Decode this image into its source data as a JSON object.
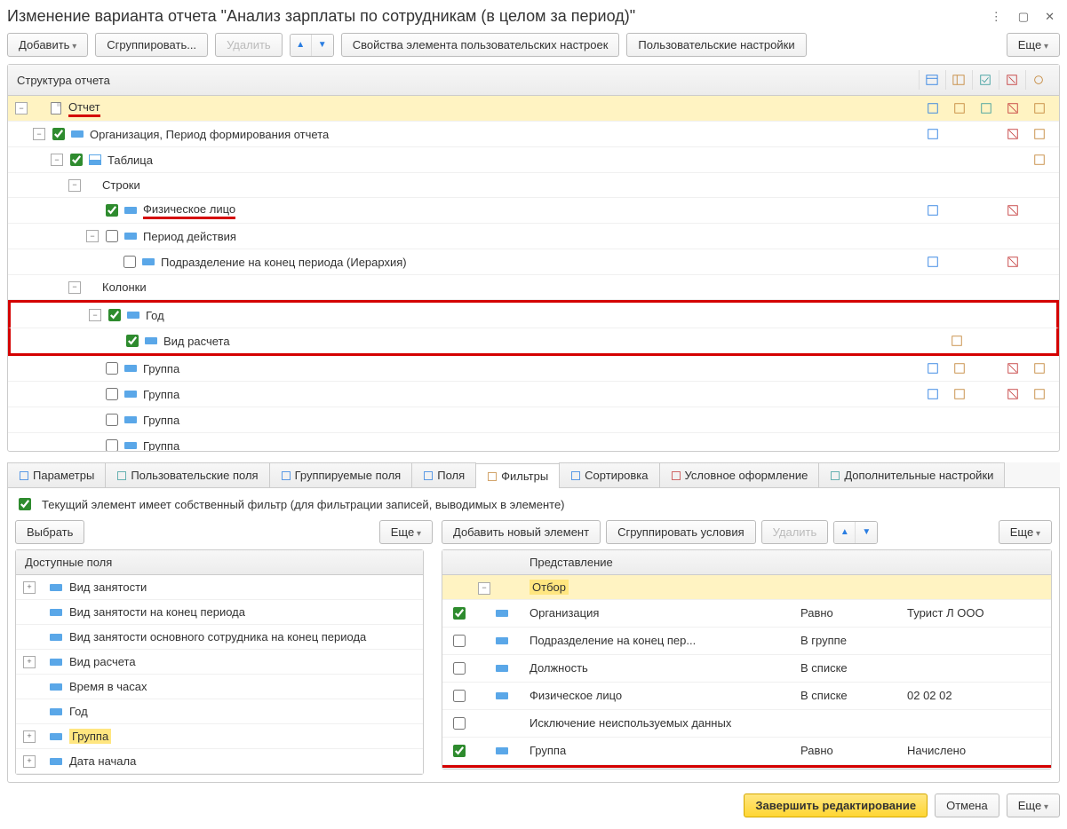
{
  "window": {
    "title": "Изменение варианта отчета \"Анализ зарплаты по сотрудникам (в целом за период)\""
  },
  "toolbar": {
    "add": "Добавить",
    "group": "Сгруппировать...",
    "delete": "Удалить",
    "props": "Свойства элемента пользовательских настроек",
    "user_settings": "Пользовательские настройки",
    "more": "Еще"
  },
  "structure": {
    "header": "Структура отчета",
    "rows": [
      {
        "indent": 0,
        "expander": "-",
        "cb": null,
        "icon": "doc",
        "label": "Отчет",
        "selected": true,
        "underline": true,
        "icons": [
          "blue",
          "orange",
          "teal",
          "red",
          "orange2"
        ]
      },
      {
        "indent": 1,
        "expander": "-",
        "cb": true,
        "icon": "field",
        "label": "Организация, Период формирования отчета",
        "icons": [
          "blue",
          "",
          "",
          "red",
          "orange2"
        ]
      },
      {
        "indent": 2,
        "expander": "-",
        "cb": true,
        "icon": "table",
        "label": "Таблица",
        "icons": [
          "",
          "",
          "",
          "",
          "orange2"
        ]
      },
      {
        "indent": 3,
        "expander": "-",
        "cb": null,
        "icon": "",
        "label": "Строки"
      },
      {
        "indent": 4,
        "expander": "",
        "cb": true,
        "icon": "field",
        "label": "Физическое лицо",
        "underline": true,
        "icons": [
          "blue",
          "",
          "",
          "red",
          ""
        ]
      },
      {
        "indent": 4,
        "expander": "-",
        "cb": false,
        "icon": "field",
        "label": "Период действия"
      },
      {
        "indent": 5,
        "expander": "",
        "cb": false,
        "icon": "field",
        "label": "Подразделение на конец периода (Иерархия)",
        "icons": [
          "blue",
          "",
          "",
          "red",
          ""
        ]
      },
      {
        "indent": 3,
        "expander": "-",
        "cb": null,
        "icon": "",
        "label": "Колонки"
      },
      {
        "indent": 4,
        "expander": "-",
        "cb": true,
        "icon": "field",
        "label": "Год",
        "boxed_start": true
      },
      {
        "indent": 5,
        "expander": "",
        "cb": true,
        "icon": "field",
        "label": "Вид расчета",
        "boxed_end": true,
        "icons": [
          "",
          "orange",
          "",
          "",
          ""
        ]
      },
      {
        "indent": 4,
        "expander": "",
        "cb": false,
        "icon": "field",
        "label": "Группа",
        "icons": [
          "blue",
          "orange",
          "",
          "red",
          "orange2"
        ]
      },
      {
        "indent": 4,
        "expander": "",
        "cb": false,
        "icon": "field",
        "label": "Группа",
        "icons": [
          "blue",
          "orange",
          "",
          "red",
          "orange2"
        ]
      },
      {
        "indent": 4,
        "expander": "",
        "cb": false,
        "icon": "field",
        "label": "Группа"
      },
      {
        "indent": 4,
        "expander": "",
        "cb": false,
        "icon": "field",
        "label": "Группа"
      }
    ]
  },
  "tabs": {
    "items": [
      {
        "icon": "blue",
        "label": "Параметры"
      },
      {
        "icon": "teal",
        "label": "Пользовательские поля"
      },
      {
        "icon": "blue",
        "label": "Группируемые поля"
      },
      {
        "icon": "blue",
        "label": "Поля"
      },
      {
        "icon": "orange",
        "label": "Фильтры",
        "active": true
      },
      {
        "icon": "blue",
        "label": "Сортировка"
      },
      {
        "icon": "red",
        "label": "Условное оформление"
      },
      {
        "icon": "teal",
        "label": "Дополнительные настройки"
      }
    ]
  },
  "filter": {
    "own_filter": "Текущий элемент имеет собственный фильтр (для фильтрации записей, выводимых в элементе)",
    "select": "Выбрать",
    "more": "Еще",
    "add_new": "Добавить новый элемент",
    "group_cond": "Сгруппировать условия",
    "delete": "Удалить",
    "avail_header": "Доступные поля",
    "avail": [
      {
        "exp": "+",
        "label": "Вид занятости"
      },
      {
        "exp": "",
        "label": "Вид занятости на конец периода"
      },
      {
        "exp": "",
        "label": "Вид занятости основного сотрудника на конец периода"
      },
      {
        "exp": "+",
        "label": "Вид расчета"
      },
      {
        "exp": "",
        "label": "Время в часах"
      },
      {
        "exp": "",
        "label": "Год"
      },
      {
        "exp": "+",
        "label": "Группа",
        "hl": true
      },
      {
        "exp": "+",
        "label": "Дата начала"
      }
    ],
    "repr_header": "Представление",
    "filters": [
      {
        "cb": null,
        "exp": "-",
        "name": "Отбор",
        "op": "",
        "val": "",
        "hl": true,
        "indent": 0
      },
      {
        "cb": true,
        "name": "Организация",
        "op": "Равно",
        "val": "Турист Л ООО",
        "indent": 1
      },
      {
        "cb": false,
        "name": "Подразделение на конец пер...",
        "op": "В группе",
        "val": "",
        "indent": 1
      },
      {
        "cb": false,
        "name": "Должность",
        "op": "В списке",
        "val": "",
        "indent": 1
      },
      {
        "cb": false,
        "name": "Физическое лицо",
        "op": "В списке",
        "val": "02 02 02",
        "indent": 1
      },
      {
        "cb": false,
        "name": "Исключение неиспользуемых данных",
        "op": "",
        "val": "",
        "indent": 1,
        "noicon": true
      },
      {
        "cb": true,
        "name": "Группа",
        "op": "Равно",
        "val": "Начислено",
        "indent": 1,
        "redline": true
      }
    ]
  },
  "footer": {
    "finish": "Завершить редактирование",
    "cancel": "Отмена",
    "more": "Еще"
  }
}
